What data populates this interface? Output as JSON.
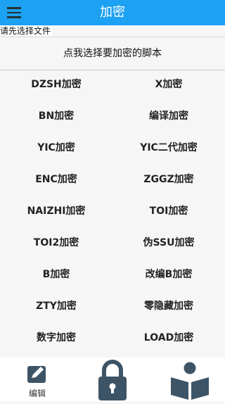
{
  "appbar": {
    "title": "加密",
    "menu_icon": "hamburger-menu-icon"
  },
  "file_status": "请先选择文件",
  "select_script_button": "点我选择要加密的脚本",
  "encrypt_options": [
    "DZSH加密",
    "X加密",
    "BN加密",
    "编译加密",
    "YIC加密",
    "YIC二代加密",
    "ENC加密",
    "ZGGZ加密",
    "NAIZHI加密",
    "TOI加密",
    "TOI2加密",
    "伪SSU加密",
    "B加密",
    "改编B加密",
    "ZTY加密",
    "零隐藏加密",
    "数字加密",
    "LOAD加密"
  ],
  "bottom_nav": {
    "edit_label": "编辑",
    "icons": [
      "edit-icon",
      "lock-icon",
      "book-reader-icon"
    ],
    "icon_color": "#3d5466"
  },
  "colors": {
    "accent": "#1da1f2"
  }
}
